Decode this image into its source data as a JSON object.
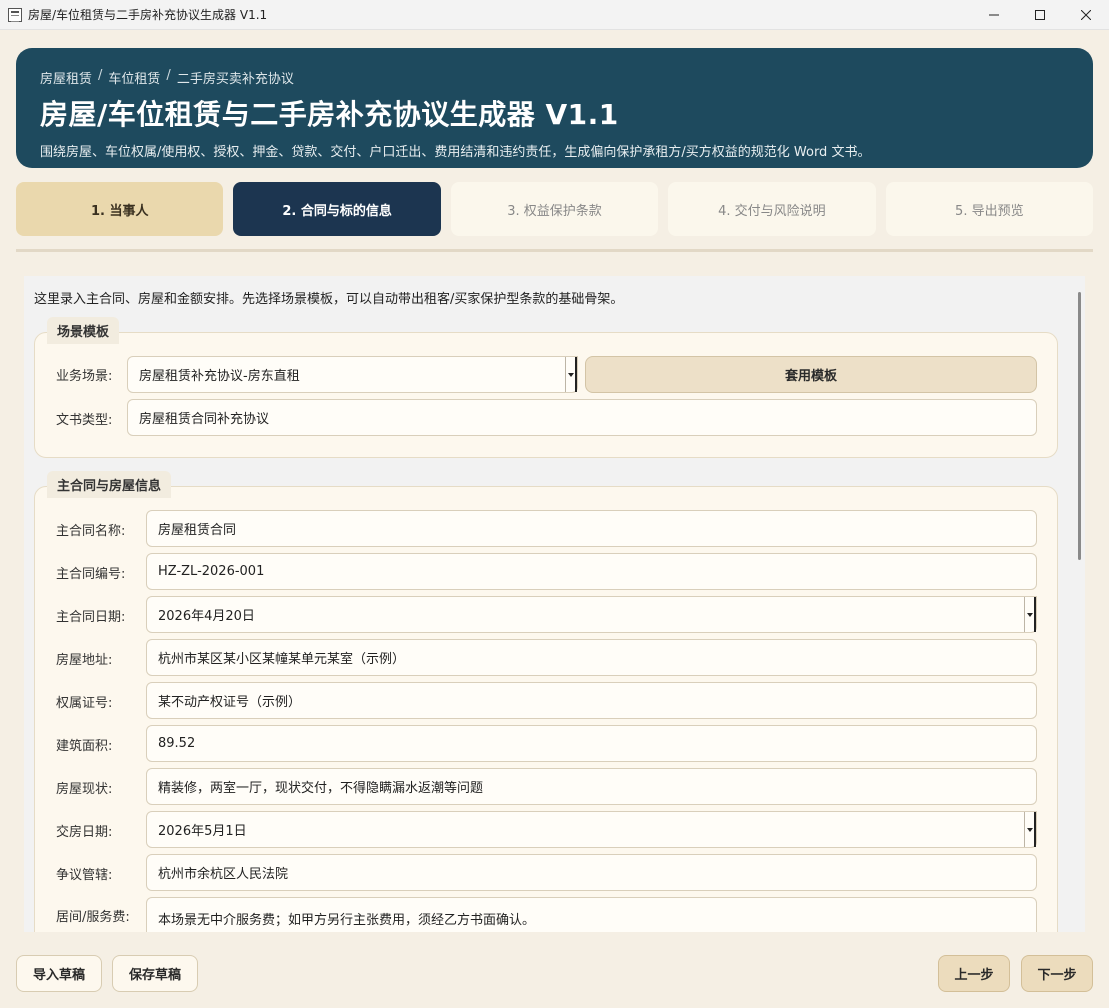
{
  "window": {
    "title": "房屋/车位租赁与二手房补充协议生成器 V1.1"
  },
  "header": {
    "breadcrumb": [
      "房屋租赁",
      "车位租赁",
      "二手房买卖补充协议"
    ],
    "breadcrumb_sep": "/",
    "title": "房屋/车位租赁与二手房补充协议生成器 V1.1",
    "subtitle": "围绕房屋、车位权属/使用权、授权、押金、贷款、交付、户口迁出、费用结清和违约责任，生成偏向保护承租方/买方权益的规范化 Word 文书。"
  },
  "steps": [
    {
      "label": "1. 当事人",
      "state": "done"
    },
    {
      "label": "2. 合同与标的信息",
      "state": "active"
    },
    {
      "label": "3. 权益保护条款",
      "state": "pending"
    },
    {
      "label": "4. 交付与风险说明",
      "state": "pending"
    },
    {
      "label": "5. 导出预览",
      "state": "pending"
    }
  ],
  "intro": "这里录入主合同、房屋和金额安排。先选择场景模板，可以自动带出租客/买家保护型条款的基础骨架。",
  "template_group": {
    "title": "场景模板",
    "scene_label": "业务场景:",
    "scene_value": "房屋租赁补充协议-房东直租",
    "apply_label": "套用模板",
    "doc_type_label": "文书类型:",
    "doc_type_value": "房屋租赁合同补充协议"
  },
  "contract_group": {
    "title": "主合同与房屋信息",
    "fields": [
      {
        "label": "主合同名称:",
        "value": "房屋租赁合同",
        "type": "text"
      },
      {
        "label": "主合同编号:",
        "value": "HZ-ZL-2026-001",
        "type": "text"
      },
      {
        "label": "主合同日期:",
        "value": "2026年4月20日",
        "type": "select"
      },
      {
        "label": "房屋地址:",
        "value": "杭州市某区某小区某幢某单元某室（示例）",
        "type": "text"
      },
      {
        "label": "权属证号:",
        "value": "某不动产权证号（示例）",
        "type": "text"
      },
      {
        "label": "建筑面积:",
        "value": "89.52",
        "type": "text"
      },
      {
        "label": "房屋现状:",
        "value": "精装修，两室一厅，现状交付，不得隐瞒漏水返潮等问题",
        "type": "text"
      },
      {
        "label": "交房日期:",
        "value": "2026年5月1日",
        "type": "select"
      },
      {
        "label": "争议管辖:",
        "value": "杭州市余杭区人民法院",
        "type": "text"
      },
      {
        "label": "居间/服务费:",
        "value": "本场景无中介服务费；如甲方另行主张费用，须经乙方书面确认。",
        "type": "textarea"
      }
    ]
  },
  "footer": {
    "import_label": "导入草稿",
    "save_label": "保存草稿",
    "prev_label": "上一步",
    "next_label": "下一步"
  }
}
